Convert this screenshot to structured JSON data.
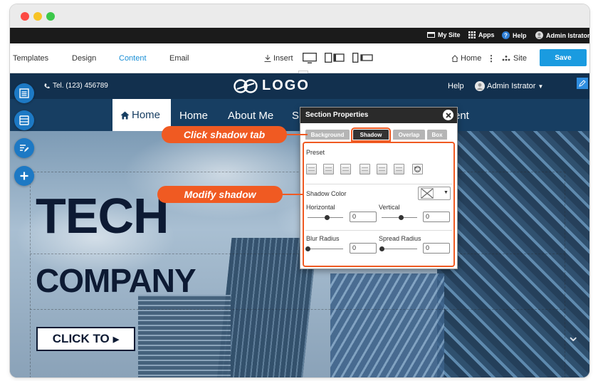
{
  "topbar": {
    "my_site": "My Site",
    "apps": "Apps",
    "help": "Help",
    "user": "Admin Istrator"
  },
  "toolbar": {
    "tabs": [
      "Templates",
      "Design",
      "Content",
      "Email"
    ],
    "active_tab": "Content",
    "insert": "Insert",
    "home": "Home",
    "site": "Site",
    "save": "Save"
  },
  "site": {
    "phone": "Tel. (123) 456789",
    "logo_text": "LOGO",
    "help": "Help",
    "user": "Admin Istrator",
    "nav": [
      "Home",
      "Home",
      "About Me",
      "S",
      "ent"
    ],
    "hero_title": "TECH",
    "hero_subtitle": "COMPANY",
    "cta": "CLICK TO"
  },
  "panel": {
    "title": "Section Properties",
    "tabs": [
      "Background",
      "Shadow",
      "Overlap",
      "Box"
    ],
    "active_tab": "Shadow",
    "preset_label": "Preset",
    "shadow_color_label": "Shadow Color",
    "horizontal_label": "Horizontal",
    "horizontal_value": "0",
    "vertical_label": "Vertical",
    "vertical_value": "0",
    "blur_label": "Blur Radius",
    "blur_value": "0",
    "spread_label": "Spread Radius",
    "spread_value": "0"
  },
  "callouts": {
    "shadow_tab": "Click shadow tab",
    "modify": "Modify shadow"
  },
  "colors": {
    "accent": "#f05a22",
    "save": "#1a9be0",
    "header": "#12304e",
    "nav": "#173e62"
  }
}
